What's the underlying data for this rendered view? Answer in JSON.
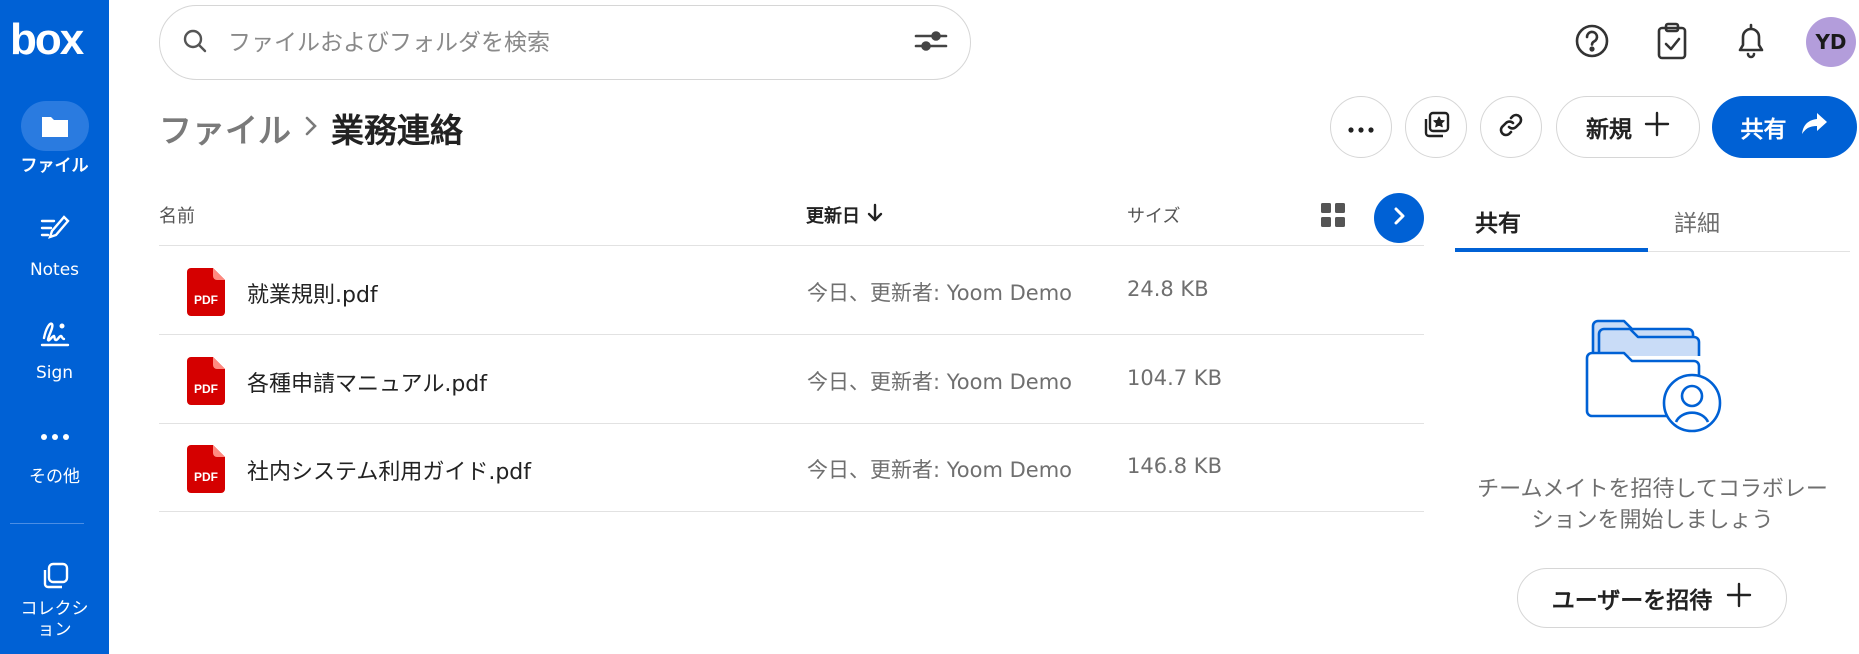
{
  "app": {
    "logo": "box"
  },
  "nav": {
    "items": [
      {
        "label": "ファイル",
        "icon": "folder-icon",
        "active": true
      },
      {
        "label": "Notes",
        "icon": "notes-icon"
      },
      {
        "label": "Sign",
        "icon": "sign-icon"
      },
      {
        "label": "その他",
        "icon": "more-icon"
      },
      {
        "label": "コレクション",
        "icon": "collections-icon"
      }
    ]
  },
  "search": {
    "placeholder": "ファイルおよびフォルダを検索",
    "value": ""
  },
  "header": {
    "icons": [
      "help-icon",
      "tasks-icon",
      "notifications-icon"
    ],
    "avatar": "YD"
  },
  "breadcrumb": {
    "root": "ファイル",
    "current": "業務連絡"
  },
  "toolbar": {
    "new_label": "新規",
    "share_label": "共有"
  },
  "table": {
    "columns": {
      "name": "名前",
      "modified": "更新日",
      "size": "サイズ"
    },
    "rows": [
      {
        "name": "就業規則.pdf",
        "modified": "今日、更新者: Yoom Demo",
        "size": "24.8 KB",
        "icon_text": "PDF"
      },
      {
        "name": "各種申請マニュアル.pdf",
        "modified": "今日、更新者: Yoom Demo",
        "size": "104.7 KB",
        "icon_text": "PDF"
      },
      {
        "name": "社内システム利用ガイド.pdf",
        "modified": "今日、更新者: Yoom Demo",
        "size": "146.8 KB",
        "icon_text": "PDF"
      }
    ]
  },
  "sidebar": {
    "tabs": [
      {
        "label": "共有",
        "active": true
      },
      {
        "label": "詳細",
        "active": false
      }
    ],
    "empty_message_line1": "チームメイトを招待してコラボレー",
    "empty_message_line2": "ションを開始しましょう",
    "invite_label": "ユーザーを招待"
  },
  "colors": {
    "brand": "#0061d5",
    "avatar": "#b39ddb",
    "pdf": "#d50000"
  }
}
